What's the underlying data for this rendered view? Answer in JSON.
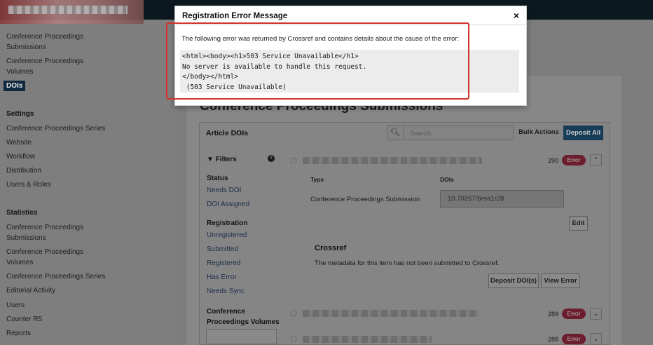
{
  "sidebar": {
    "items_top": [
      {
        "label": "Conference Proceedings\nSubmissions"
      },
      {
        "label": "Conference Proceedings\nVolumes"
      },
      {
        "label": "DOIs"
      }
    ],
    "settings_heading": "Settings",
    "settings_items": [
      {
        "label": "Conference Proceedings Series"
      },
      {
        "label": "Website"
      },
      {
        "label": "Workflow"
      },
      {
        "label": "Distribution"
      },
      {
        "label": "Users & Roles"
      }
    ],
    "statistics_heading": "Statistics",
    "statistics_items": [
      {
        "label": "Conference Proceedings\nSubmissions"
      },
      {
        "label": "Conference Proceedings\nVolumes"
      },
      {
        "label": "Conference Proceedings Series"
      },
      {
        "label": "Editorial Activity"
      },
      {
        "label": "Users"
      },
      {
        "label": "Counter R5"
      },
      {
        "label": "Reports"
      }
    ]
  },
  "main": {
    "page_title": "Conference Proceedings Submissions",
    "card_title": "Article DOIs",
    "search_placeholder": "Search",
    "bulk_actions_label": "Bulk Actions",
    "deposit_all_label": "Deposit All",
    "filters": {
      "heading": "Filters",
      "status_heading": "Status",
      "status_items": [
        "Needs DOI",
        "DOI Assigned"
      ],
      "registration_heading": "Registration",
      "registration_items": [
        "Unregistered",
        "Submitted",
        "Registered",
        "Has Error",
        "Needs Sync"
      ],
      "volumes_heading": "Conference\nProceedings Volumes"
    },
    "rows": [
      {
        "count": "290",
        "status": "Error",
        "expanded": true
      },
      {
        "count": "289",
        "status": "Error",
        "expanded": false
      },
      {
        "count": "288",
        "status": "Error",
        "expanded": false
      }
    ],
    "detail": {
      "type_header": "Type",
      "dois_header": "DOIs",
      "type_value": "Conference Proceedings Submission",
      "doi_value": "10.70267/6rea1r28",
      "edit_label": "Edit",
      "crossref_heading": "Crossref",
      "crossref_text": "The metadata for this item has not been submitted to Crossref.",
      "deposit_label": "Deposit DOI(s)",
      "view_error_label": "View Error"
    }
  },
  "modal": {
    "title": "Registration Error Message",
    "close_glyph": "×",
    "intro": "The following error was returned by Crossref and contains details about the cause of the error:",
    "code_lines": [
      "<html><body><h1>503 Service Unavailable</h1>",
      "No server is available to handle this request.",
      "</body></html>",
      " (503 Service Unavailable)"
    ]
  },
  "colors": {
    "highlight": "#d0342c",
    "error_badge": "#8b2a3c",
    "primary": "#1d4e73"
  }
}
